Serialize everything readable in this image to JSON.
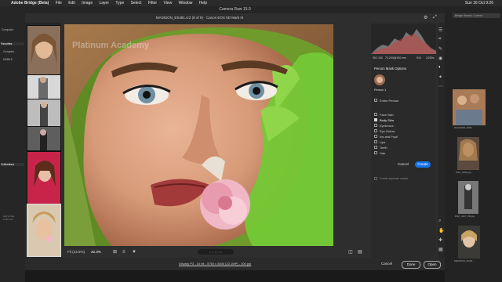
{
  "menubar": {
    "app_name": "Adobe Bridge (Beta)",
    "items": [
      "File",
      "Edit",
      "Image",
      "Layer",
      "Type",
      "Select",
      "Filter",
      "View",
      "Window",
      "Help"
    ],
    "clock": "Sun 16 Oct 9:26"
  },
  "bridge": {
    "left_tabs": [
      "Computer",
      "Favorites",
      "Collections"
    ],
    "left_items": [
      "Computer",
      "MOBILE"
    ],
    "add_item_hint": "Add a New Collection",
    "search_placeholder": "Bridge Search: Current",
    "right_files": [
      "DSC06451.ARW",
      "DSC_0161.jpg",
      "DSC_4117_ZR.jpg",
      "MADISON_ES48..."
    ]
  },
  "camera_raw": {
    "title": "Camera Raw 15.0",
    "file_info": "MADISON_ES481.cr2 (8 of 9)  ·  Canon EOS 5D Mark III",
    "histogram_info": {
      "iso": "ISO 100",
      "lens": "70-200@190 mm",
      "aperture": "f/10",
      "shutter": "1/250s"
    },
    "panel": {
      "header": "Person Mask Options",
      "person_label": "Person 1",
      "entire_person": "Entire Person",
      "options": [
        {
          "label": "Face Skin",
          "checked": false
        },
        {
          "label": "Body Skin",
          "checked": true
        },
        {
          "label": "Eyebrows",
          "checked": false
        },
        {
          "label": "Eye Sclera",
          "checked": false
        },
        {
          "label": "Iris and Pupil",
          "checked": false
        },
        {
          "label": "Lips",
          "checked": false
        },
        {
          "label": "Teeth",
          "checked": false
        },
        {
          "label": "Hair",
          "checked": false
        }
      ],
      "cancel": "Cancel",
      "create": "Create",
      "separate_masks": "Create separate masks"
    },
    "bottom": {
      "fit": "Fit (14.5%)",
      "zoom": "32.3%"
    },
    "footer": {
      "profile_link": "Display P3 - 16 bit - 5760 x 3840 (22.1MP) - 300 ppi",
      "cancel": "Cancel",
      "done": "Done",
      "open": "Open"
    },
    "watermark": "Platinum Academy"
  },
  "colors": {
    "accent_blue": "#1473e6",
    "mask_green": "#74c935"
  }
}
